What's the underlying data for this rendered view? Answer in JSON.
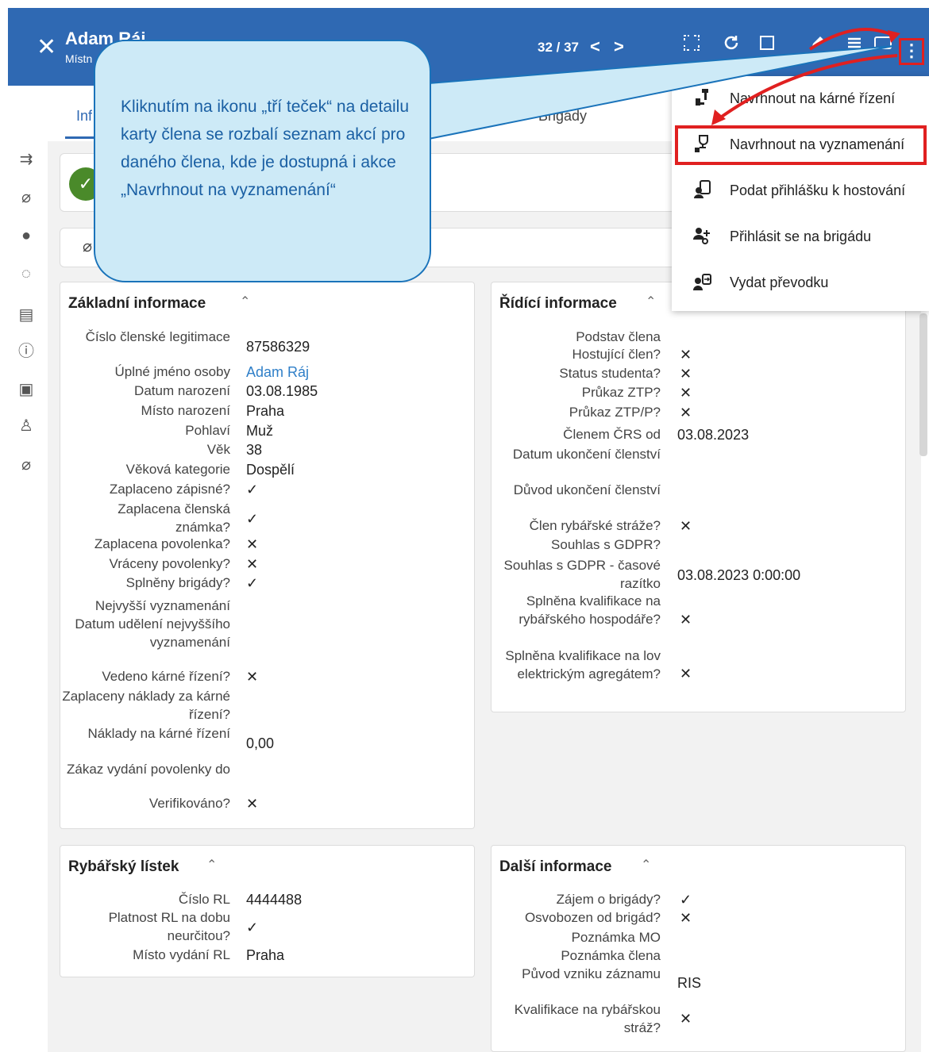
{
  "header": {
    "title": "Adam Ráj",
    "subtitle": "Místn",
    "pager": "32 / 37",
    "prev": "<",
    "next": ">",
    "close": "✕",
    "more": "⋮"
  },
  "tabs": [
    {
      "label": "Inf"
    },
    {
      "label": "Brigády"
    }
  ],
  "callout": {
    "text": "Kliknutím na ikonu „tří teček“ na detailu karty člena se rozbalí seznam akcí pro daného člena, kde je dostupná i akce „Navrhnout na vyznamenání“"
  },
  "menu": {
    "items": [
      {
        "label": "Navrhnout na kárné řízení",
        "icon": "gavel-icon"
      },
      {
        "label": "Navrhnout na vyznamenání",
        "icon": "trophy-icon"
      },
      {
        "label": "Podat přihlášku k hostování",
        "icon": "document-user-icon"
      },
      {
        "label": "Přihlásit se na brigádu",
        "icon": "user-add-icon"
      },
      {
        "label": "Vydat převodku",
        "icon": "user-transfer-icon"
      }
    ]
  },
  "zakladni": {
    "title": "Základní informace",
    "rows": [
      {
        "label": "Číslo členské legitimace",
        "value": "87586329"
      },
      {
        "label": "Úplné jméno osoby",
        "value": "Adam Ráj"
      },
      {
        "label": "Datum narození",
        "value": "03.08.1985"
      },
      {
        "label": "Místo narození",
        "value": "Praha"
      },
      {
        "label": "Pohlaví",
        "value": "Muž"
      },
      {
        "label": "Věk",
        "value": "38"
      },
      {
        "label": "Věková kategorie",
        "value": "Dospělí"
      },
      {
        "label": "Zaplaceno zápisné?",
        "value": "✓"
      },
      {
        "label": "Zaplacena členská známka?",
        "value": "✓"
      },
      {
        "label": "Zaplacena povolenka?",
        "value": "✕"
      },
      {
        "label": "Vráceny povolenky?",
        "value": "✕"
      },
      {
        "label": "Splněny brigády?",
        "value": "✓"
      },
      {
        "label": "Nejvyšší vyznamenání",
        "value": ""
      },
      {
        "label": "Datum udělení nejvyššího vyznamenání",
        "value": ""
      },
      {
        "label": "Vedeno kárné řízení?",
        "value": "✕"
      },
      {
        "label": "Zaplaceny náklady za kárné řízení?",
        "value": ""
      },
      {
        "label": "Náklady na kárné řízení",
        "value": "0,00"
      },
      {
        "label": "Zákaz vydání povolenky do",
        "value": ""
      },
      {
        "label": "Verifikováno?",
        "value": "✕"
      }
    ]
  },
  "ridici": {
    "title": "Řídící informace",
    "rows": [
      {
        "label": "Podstav člena",
        "value": ""
      },
      {
        "label": "Hostující člen?",
        "value": "✕"
      },
      {
        "label": "Status studenta?",
        "value": "✕"
      },
      {
        "label": "Průkaz ZTP?",
        "value": "✕"
      },
      {
        "label": "Průkaz ZTP/P?",
        "value": "✕"
      },
      {
        "label": "Členem ČRS od",
        "value": "03.08.2023"
      },
      {
        "label": "Datum ukončení členství",
        "value": ""
      },
      {
        "label": "Důvod ukončení členství",
        "value": ""
      },
      {
        "label": "Člen rybářské stráže?",
        "value": "✕"
      },
      {
        "label": "Souhlas s GDPR?",
        "value": ""
      },
      {
        "label": "Souhlas s GDPR - časové razítko",
        "value": "03.08.2023 0:00:00"
      },
      {
        "label": "Splněna kvalifikace na rybářského hospodáře?",
        "value": "✕"
      },
      {
        "label": "Splněna kvalifikace na lov elektrickým agregátem?",
        "value": "✕"
      }
    ]
  },
  "rybarsky": {
    "title": "Rybářský lístek",
    "rows": [
      {
        "label": "Číslo RL",
        "value": "4444488"
      },
      {
        "label": "Platnost RL na dobu neurčitou?",
        "value": "✓"
      },
      {
        "label": "Místo vydání RL",
        "value": "Praha"
      }
    ]
  },
  "dalsi": {
    "title": "Další informace",
    "rows": [
      {
        "label": "Zájem o brigády?",
        "value": "✓"
      },
      {
        "label": "Osvobozen od brigád?",
        "value": "✕"
      },
      {
        "label": "Poznámka MO",
        "value": ""
      },
      {
        "label": "Poznámka člena",
        "value": ""
      },
      {
        "label": "Původ vzniku záznamu",
        "value": "RIS"
      },
      {
        "label": "Kvalifikace na rybářskou stráž?",
        "value": "✕"
      }
    ]
  },
  "colors": {
    "header": "#2f69b3",
    "highlight": "#e02020",
    "callout_bg": "#cdeaf7",
    "callout_text": "#1a5fa3"
  }
}
